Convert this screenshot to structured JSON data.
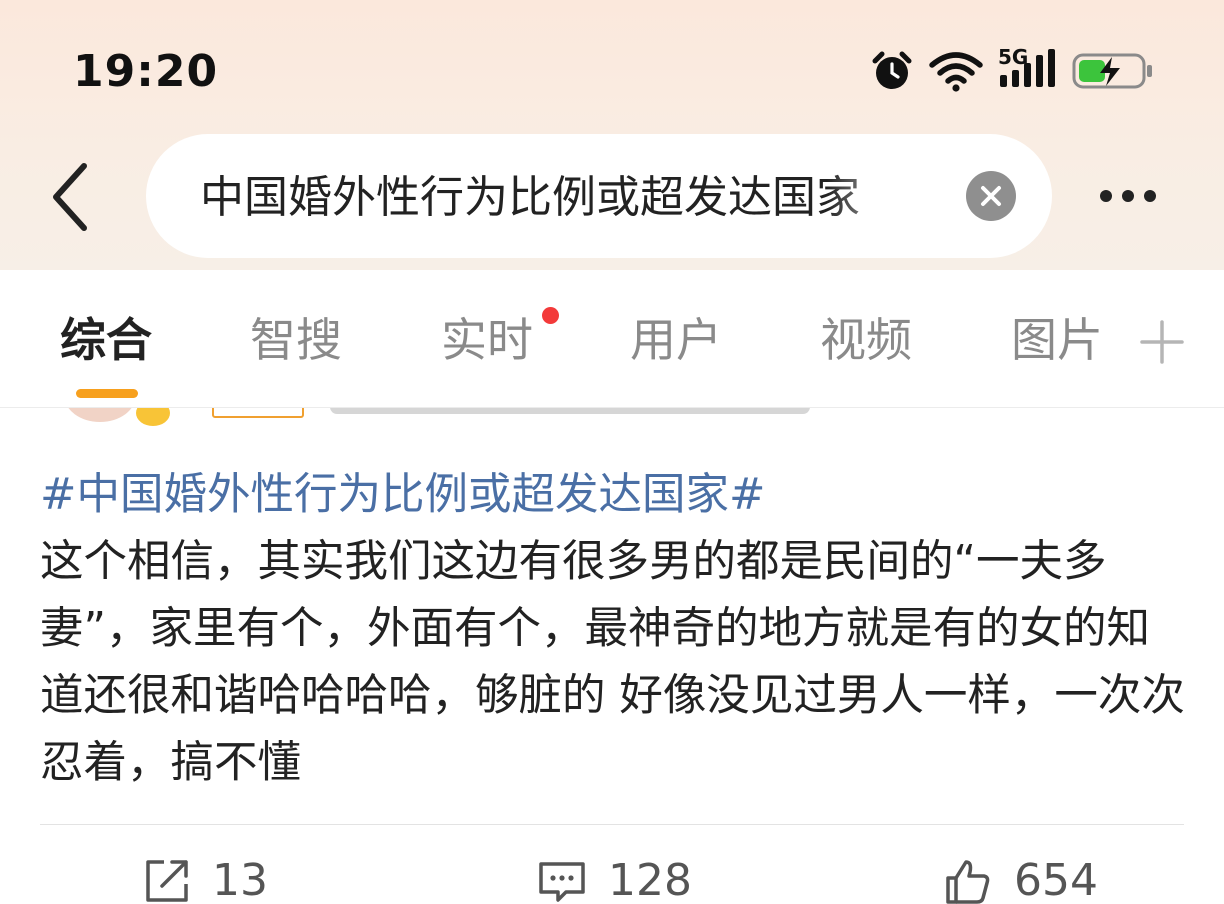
{
  "status_bar": {
    "time": "19:20",
    "network_label": "5G",
    "icons": [
      "alarm-icon",
      "wifi-icon",
      "signal-icon",
      "battery-charging-icon"
    ],
    "battery_color": "#3cc43c"
  },
  "header": {
    "back_icon": "chevron-left-icon",
    "search_query": "中国婚外性行为比例或超发达国家",
    "clear_icon": "close-icon",
    "more_icon": "more-dots-icon"
  },
  "tabs": {
    "items": [
      {
        "label": "综合",
        "active": true
      },
      {
        "label": "智搜",
        "active": false
      },
      {
        "label": "实时",
        "active": false,
        "badge": "red-dot"
      },
      {
        "label": "用户",
        "active": false
      },
      {
        "label": "视频",
        "active": false
      },
      {
        "label": "图片",
        "active": false
      }
    ],
    "add_icon": "plus-icon",
    "accent_color": "#f7a01e"
  },
  "post": {
    "topic": "#中国婚外性行为比例或超发达国家#",
    "body": "这个相信，其实我们这边有很多男的都是民间的“一夫多妻”，家里有个，外面有个，最神奇的地方就是有的女的知道还很和谐哈哈哈哈，够脏的 好像没见过男人一样，一次次忍着，搞不懂",
    "topic_color": "#4a6fa5"
  },
  "actions": {
    "repost_count": "13",
    "comment_count": "128",
    "like_count": "654"
  }
}
